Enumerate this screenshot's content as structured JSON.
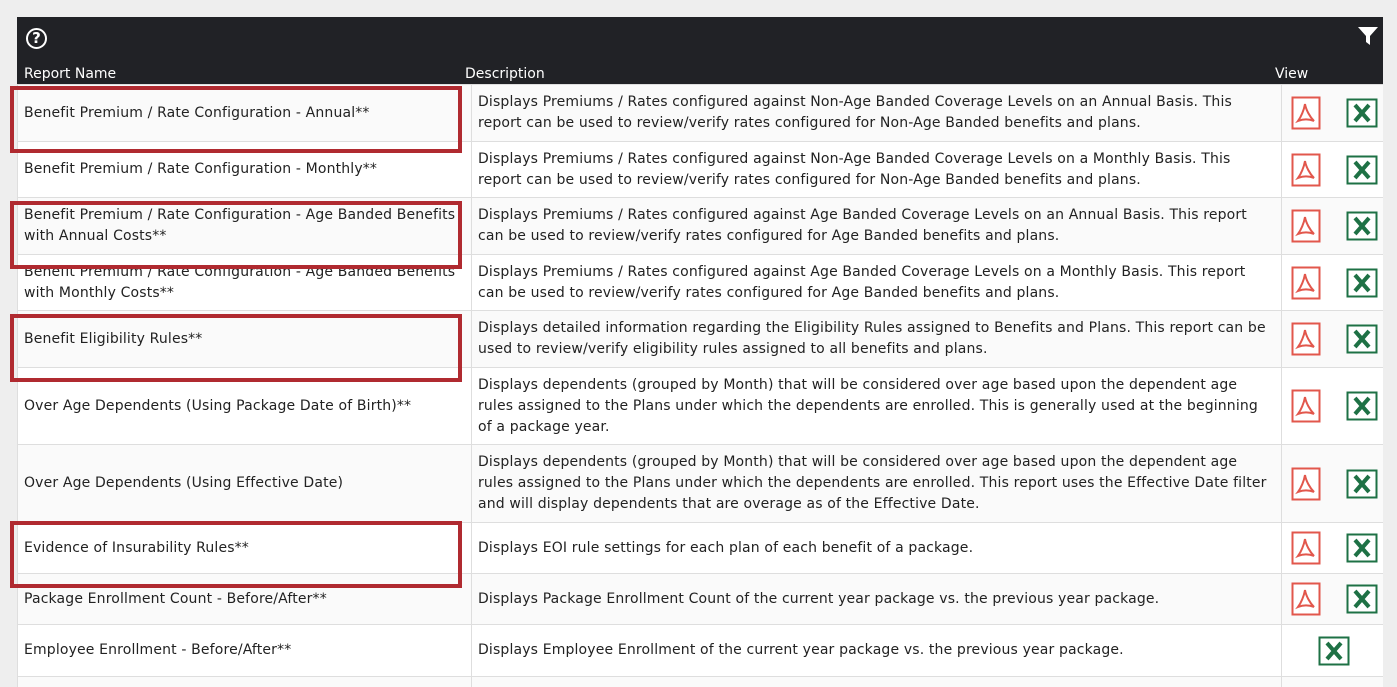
{
  "toolbar": {
    "help_icon": "?",
    "filter_icon": "filter-icon"
  },
  "columns": {
    "name": "Report Name",
    "description": "Description",
    "view": "View"
  },
  "rows": [
    {
      "name": "Benefit Premium / Rate Configuration - Annual**",
      "description": "Displays Premiums / Rates configured against Non-Age Banded Coverage Levels on an Annual Basis. This report can be used to review/verify rates configured for Non-Age Banded benefits and plans.",
      "highlighted": true
    },
    {
      "name": "Benefit Premium / Rate Configuration - Monthly**",
      "description": "Displays Premiums / Rates configured against Non-Age Banded Coverage Levels on a Monthly Basis. This report can be used to review/verify rates configured for Non-Age Banded benefits and plans.",
      "highlighted": false
    },
    {
      "name": "Benefit Premium / Rate Configuration - Age Banded Benefits with Annual Costs**",
      "description": "Displays Premiums / Rates configured against Age Banded Coverage Levels on an Annual Basis. This report can be used to review/verify rates configured for Age Banded benefits and plans.",
      "highlighted": true
    },
    {
      "name": "Benefit Premium / Rate Configuration - Age Banded Benefits with Monthly Costs**",
      "description": "Displays Premiums / Rates configured against Age Banded Coverage Levels on a Monthly Basis. This report can be used to review/verify rates configured for Age Banded benefits and plans.",
      "highlighted": false
    },
    {
      "name": "Benefit Eligibility Rules**",
      "description": "Displays detailed information regarding the Eligibility Rules assigned to Benefits and Plans. This report can be used to review/verify eligibility rules assigned to all benefits and plans.",
      "highlighted": true
    },
    {
      "name": "Over Age Dependents (Using Package Date of Birth)**",
      "description": "Displays dependents (grouped by Month) that will be considered over age based upon the dependent age rules assigned to the Plans under which the dependents are enrolled. This is generally used at the beginning of a package year.",
      "highlighted": false
    },
    {
      "name": "Over Age Dependents (Using Effective Date)",
      "description": "Displays dependents (grouped by Month) that will be considered over age based upon the dependent age rules assigned to the Plans under which the dependents are enrolled. This report uses the Effective Date filter and will display dependents that are overage as of the Effective Date.",
      "highlighted": false
    },
    {
      "name": "Evidence of Insurability Rules**",
      "description": "Displays EOI rule settings for each plan of each benefit of a package.",
      "highlighted": true
    },
    {
      "name": "Package Enrollment Count - Before/After**",
      "description": "Displays Package Enrollment Count of the current year package vs. the previous year package.",
      "highlighted": false
    },
    {
      "name": "Employee Enrollment - Before/After**",
      "description": "Displays Employee Enrollment of the current year package vs. the previous year package.",
      "highlighted": false
    }
  ],
  "colors": {
    "header_bg": "#212226",
    "pdf": "#e2574c",
    "excel": "#1e7145",
    "highlight": "#b02a30"
  }
}
